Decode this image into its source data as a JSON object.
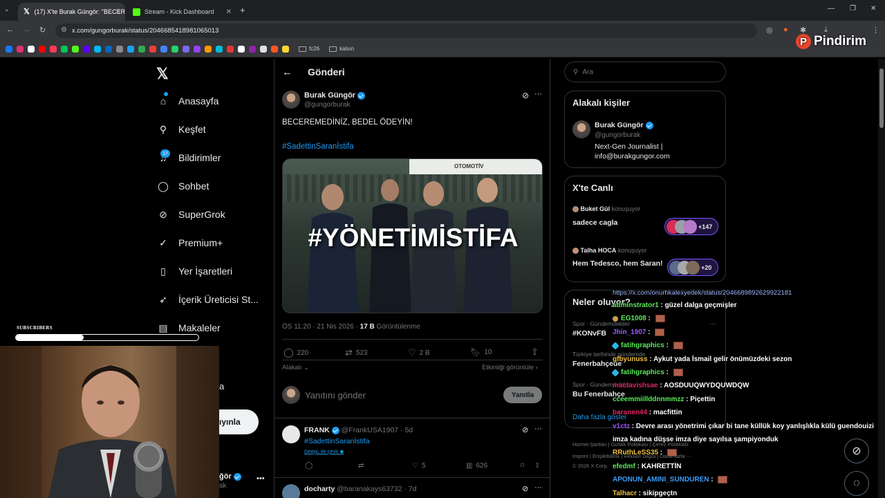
{
  "browser": {
    "tabs": [
      {
        "title": "(17) X'te Burak Güngör: \"BECER",
        "active": true
      },
      {
        "title": "Stream - Kick Dashboard",
        "active": false
      }
    ],
    "url": "x.com/gungorburak/status/2046685418981065013",
    "bookmark_folders": [
      "fc26",
      "kalsın"
    ],
    "bookmark_colors": [
      "#1877f2",
      "#e1306c",
      "#ffffff",
      "#ff0000",
      "#ff3b5c",
      "#00c853",
      "#53fc18",
      "#5c00ff",
      "#00b7ff",
      "#0a66c2",
      "#8a8a8a",
      "#1da1f2",
      "#34a853",
      "#ea4335",
      "#4285f4",
      "#25d366",
      "#7b68ee",
      "#9146ff",
      "#ff9800",
      "#00bcd4",
      "#e53935",
      "#ffffff",
      "#8e24aa",
      "#e0e0e0",
      "#ff5722",
      "#fdd835"
    ]
  },
  "brand_watermark": "Pindirim",
  "nav": {
    "items": [
      {
        "label": "Anasayfa",
        "icon": "home-icon"
      },
      {
        "label": "Keşfet",
        "icon": "search-icon"
      },
      {
        "label": "Bildirimler",
        "icon": "bell-icon",
        "badge": "17"
      },
      {
        "label": "Sohbet",
        "icon": "chat-icon"
      },
      {
        "label": "SuperGrok",
        "icon": "grok-icon"
      },
      {
        "label": "Premium+",
        "icon": "premium-icon"
      },
      {
        "label": "Yer İşaretleri",
        "icon": "bookmark-icon"
      },
      {
        "label": "İçerik Üreticisi St...",
        "icon": "rocket-icon"
      },
      {
        "label": "Makaleler",
        "icon": "article-icon"
      }
    ],
    "post_button_fragment": "ıyınla",
    "profile_name_fragment": "ğör",
    "profile_handle_fragment": "ak",
    "partial_a": "a"
  },
  "overlay": {
    "subscribers_label": "SUBSCRIBERS",
    "subscribers_progress": 0.37
  },
  "tweet": {
    "header": "Gönderi",
    "author": "Burak Güngör",
    "handle": "@gungorburak",
    "text": "BECEREMEDİNİZ, BEDEL ÖDEYİN!",
    "hashtag": "#SadettinSaranİstifa",
    "image_text": "#YÖNETİMİSTİFA",
    "image_sign": "OTOMOTİV",
    "time": "ÖS 11:20 · 21 Nis 2026 · ",
    "views_count": "17 B",
    "views_label": " Görüntülenme",
    "replies": "220",
    "retweets": "523",
    "likes": "2 B",
    "bookmarks": "10",
    "relevant_label": "Alakalı",
    "activity_label": "Etkinliği görüntüle",
    "reply_placeholder": "Yanıtını gönder",
    "reply_button": "Yanıtla"
  },
  "replies": [
    {
      "name": "FRANK",
      "handle": "@FrankUSA1907 · 5d",
      "hashtag": "#SadettinSaranİstifa",
      "translate": "DeepL ile çevir",
      "likes": "5",
      "views": "626"
    },
    {
      "name": "docharty",
      "handle": "@baranakays63732 · 7d"
    }
  ],
  "right": {
    "search_placeholder": "Ara",
    "related_title": "Alakalı kişiler",
    "related_name": "Burak Güngör",
    "related_handle": "@gungorburak",
    "related_bio_1": "Next-Gen Journalist |",
    "related_bio_2": "info@burakgungor.com",
    "live_title": "X'te Canlı",
    "live": [
      {
        "host": "Buket Gül",
        "status": "konuşuyor",
        "title": "sadece cagla",
        "count": "+147"
      },
      {
        "host": "Talha HOCA",
        "status": "konuşuyor",
        "title": "Hem Tedesco, hem Saran!",
        "count": "+20"
      }
    ],
    "trends_title": "Neler oluyor?",
    "trends": [
      {
        "category": "Spor · Gündemdekiler",
        "name": "#KONvFB"
      },
      {
        "category": "Türkiye tarihinde gündemde",
        "name": "Fenerbahçede"
      },
      {
        "category": "Spor · Gündemdekiler",
        "name": "Bu Fenerbahçe"
      }
    ],
    "show_more": "Daha fazla göster",
    "footer_1": "Hizmet Şartları",
    "footer_2": "Gizlilik Politikası",
    "footer_3": "Çerez Politikası",
    "footer_4": "Imprint",
    "footer_5": "Erişilebilirlik",
    "footer_6": "Reklam bilgisi",
    "footer_7": "Daha fazla ···",
    "copyright": "© 2026 X Corp."
  },
  "chat": {
    "link_line": "https://x.com/onurhkalexyedek/status/2046689892629922181",
    "messages": [
      {
        "user": "adminstrator1",
        "color": "#59e85a",
        "text": "güzel dalga geçmişler"
      },
      {
        "user": "EG1008",
        "color": "#59e85a",
        "text": "",
        "emote": true,
        "badge": "circle"
      },
      {
        "user": "Jhin_1907",
        "color": "#9b59ff",
        "text": "",
        "emote": true
      },
      {
        "user": "fatihgraphics",
        "color": "#59e85a",
        "text": "",
        "emote": true,
        "badge": "diamond"
      },
      {
        "user": "gfbyunuss",
        "color": "#f0c040",
        "text": "Aykut yada İsmail gelir önümüzdeki sezon"
      },
      {
        "user": "fatihgraphics",
        "color": "#59e85a",
        "text": "",
        "emote": true,
        "badge": "diamond"
      },
      {
        "user": "mactavishsae",
        "color": "#e0245e",
        "text": "AOSDUUQWYDQUWDQW"
      },
      {
        "user": "cceemmiillddnnmmzz",
        "color": "#59e85a",
        "text": "Piçettin"
      },
      {
        "user": "baranen44",
        "color": "#e0245e",
        "text": "macfittin"
      },
      {
        "user": "v1ctz",
        "color": "#9b59ff",
        "text": "Devre arası yönetrimi çıkar bi tane küllük koy yanlışlıkla külü guendouizi"
      },
      {
        "user": "",
        "color": "#ffffff",
        "text": "imza kadına düşse imza diye sayılsa şampiyonduk"
      },
      {
        "user": "RRuthLeSS35",
        "color": "#f0c040",
        "text": "",
        "emote": true
      },
      {
        "user": "efedmf",
        "color": "#59e85a",
        "text": "KAHRETTİN"
      },
      {
        "user": "APONUN_AMINI_SUNDUREN",
        "color": "#3b9eff",
        "text": "",
        "emote": true
      },
      {
        "user": "Talhacr",
        "color": "#f0c040",
        "text": "sikipgeçtn"
      }
    ]
  }
}
